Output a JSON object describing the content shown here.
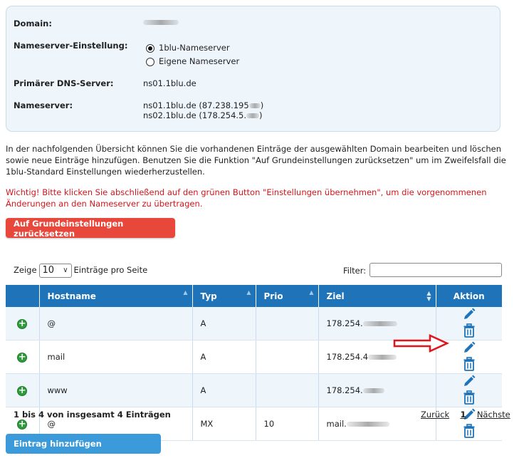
{
  "info": {
    "domain_label": "Domain:",
    "ns_setting_label": "Nameserver-Einstellung:",
    "ns_options": [
      "1blu-Nameserver",
      "Eigene Nameserver"
    ],
    "ns_selected": "1blu-Nameserver",
    "primary_dns_label": "Primärer DNS-Server:",
    "primary_dns_value": "ns01.1blu.de",
    "nameserver_label": "Nameserver:",
    "nameserver_1": "ns01.1blu.de (87.238.195",
    "nameserver_1_close": ")",
    "nameserver_2": "ns02.1blu.de (178.254.5.",
    "nameserver_2_close": ")"
  },
  "text": {
    "intro_line1": "In der nachfolgenden Übersicht können Sie die vorhandenen Einträge der ausgewählten Domain bearbeiten und löschen",
    "intro_line2": "sowie neue Einträge hinzufügen. Benutzen Sie die Funktion \"Auf Grundeinstellungen zurücksetzen\" um im Zweifelsfall die",
    "intro_line3": "1blu-Standard Einstellungen wiederherzustellen.",
    "warn_line1": "Wichtig! Bitte klicken Sie abschließend auf den grünen Button \"Einstellungen übernehmen\", um die vorgenommenen",
    "warn_line2": "Änderungen an den Nameserver zu übertragen."
  },
  "buttons": {
    "reset": "Auf Grundeinstellungen zurücksetzen",
    "add_entry": "Eintrag hinzufügen"
  },
  "controls": {
    "show_label": "Zeige",
    "page_size": "10",
    "per_page_label": "Einträge pro Seite",
    "filter_label": "Filter:"
  },
  "table": {
    "columns": [
      "",
      "Hostname",
      "Typ",
      "Prio",
      "Ziel",
      "Aktion"
    ],
    "rows": [
      {
        "hostname": "@",
        "typ": "A",
        "prio": "",
        "ziel": "178.254."
      },
      {
        "hostname": "mail",
        "typ": "A",
        "prio": "",
        "ziel": "178.254.4"
      },
      {
        "hostname": "www",
        "typ": "A",
        "prio": "",
        "ziel": "178.254."
      },
      {
        "hostname": "@",
        "typ": "MX",
        "prio": "10",
        "ziel": "mail."
      }
    ]
  },
  "footer": {
    "summary": "1 bis 4 von insgesamt 4 Einträgen",
    "prev": "Zurück",
    "page": "1",
    "next": "Nächste"
  },
  "colors": {
    "header_blue": "#1e73b9",
    "reset_red": "#e8483b",
    "add_blue": "#3b9ad9",
    "warning_red": "#d3161b",
    "plus_green": "#2e9b3d",
    "annotation_arrow": "#e0161b"
  },
  "icons": [
    "plus-circle-icon",
    "pencil-edit-icon",
    "trash-icon",
    "sort-arrow-icon",
    "chevron-down-icon",
    "red-arrow-annotation"
  ]
}
